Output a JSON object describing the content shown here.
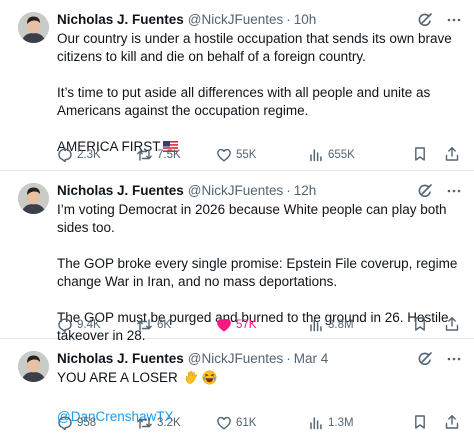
{
  "tweets": [
    {
      "name": "Nicholas J. Fuentes",
      "handle": "@NickJFuentes",
      "separator": "·",
      "time": "10h",
      "paragraphs": [
        "Our country is under a hostile occupation that sends its own brave citizens to kill and die on behalf of a foreign country.",
        "It’s time to put aside all differences with all people and unite as Americans against the occupation regime.",
        "AMERICA FIRST"
      ],
      "replies": "2.3K",
      "reposts": "7.5K",
      "likes": "55K",
      "views": "655K",
      "liked": false
    },
    {
      "name": "Nicholas J. Fuentes",
      "handle": "@NickJFuentes",
      "separator": "·",
      "time": "12h",
      "paragraphs": [
        "I’m voting Democrat in 2026 because White people can play both sides too.",
        "The GOP broke every single promise: Epstein File coverup, regime change War in Iran, and no mass deportations.",
        "The GOP must be purged and burned to the ground in 26. Hostile takeover in 28."
      ],
      "replies": "9.4K",
      "reposts": "6K",
      "likes": "57K",
      "views": "3.8M",
      "liked": true
    },
    {
      "name": "Nicholas J. Fuentes",
      "handle": "@NickJFuentes",
      "separator": "·",
      "time": "Mar 4",
      "paragraphs": [
        "YOU ARE A LOSER",
        "@DanCrenshawTX"
      ],
      "replies": "958",
      "reposts": "3.2K",
      "likes": "61K",
      "views": "1.3M",
      "liked": false
    }
  ],
  "icons": {
    "reply": "reply-icon",
    "repost": "repost-icon",
    "like": "heart-icon",
    "views": "views-icon",
    "bookmark": "bookmark-icon",
    "share": "share-icon",
    "grok": "grok-icon",
    "more": "more-icon"
  },
  "colors": {
    "text": "#0f1419",
    "muted": "#536471",
    "link": "#1d9bf0",
    "like": "#f91880",
    "divider": "#e6e9eb"
  }
}
